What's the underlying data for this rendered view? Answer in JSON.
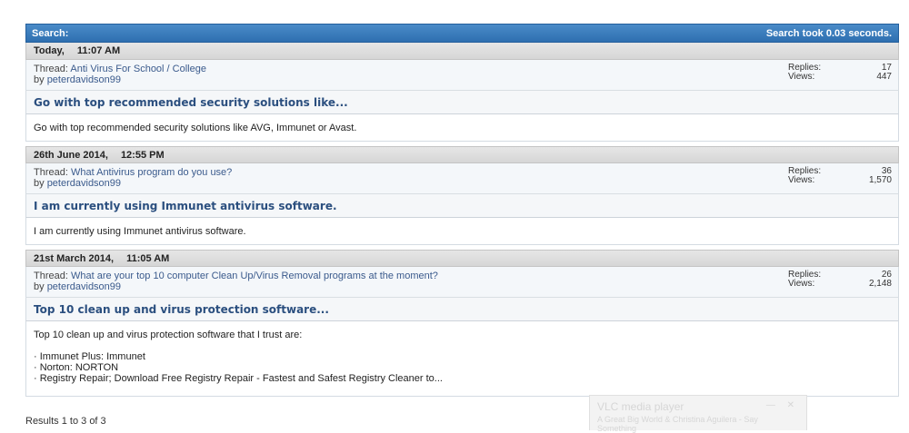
{
  "header": {
    "title": "Search:",
    "time_text": "Search took 0.03 seconds."
  },
  "results": [
    {
      "date": "Today,",
      "time": "11:07 AM",
      "thread_label": "Thread:",
      "thread_title": "Anti Virus For School / College",
      "by_label": "by",
      "author": "peterdavidson99",
      "replies_label": "Replies:",
      "replies": "17",
      "views_label": "Views:",
      "views": "447",
      "post_title": "Go with top recommended security solutions like...",
      "post_lines": [
        "Go with top recommended security solutions like AVG, Immunet or Avast."
      ]
    },
    {
      "date": "26th June 2014,",
      "time": "12:55 PM",
      "thread_label": "Thread:",
      "thread_title": "What Antivirus program do you use?",
      "by_label": "by",
      "author": "peterdavidson99",
      "replies_label": "Replies:",
      "replies": "36",
      "views_label": "Views:",
      "views": "1,570",
      "post_title": "I am currently using Immunet antivirus software.",
      "post_lines": [
        "I am currently using Immunet antivirus software."
      ]
    },
    {
      "date": "21st March 2014,",
      "time": "11:05 AM",
      "thread_label": "Thread:",
      "thread_title": "What are your top 10 computer Clean Up/Virus Removal programs at the moment?",
      "by_label": "by",
      "author": "peterdavidson99",
      "replies_label": "Replies:",
      "replies": "26",
      "views_label": "Views:",
      "views": "2,148",
      "post_title": "Top 10 clean up and virus protection software...",
      "post_lines": [
        "Top 10 clean up and virus protection software that I trust are:",
        "",
        "· Immunet Plus: Immunet",
        "· Norton: NORTON",
        "· Registry Repair; Download Free Registry Repair - Fastest and Safest Registry Cleaner to..."
      ]
    }
  ],
  "footer": {
    "results_text": "Results 1 to 3 of 3"
  },
  "vlc_popup": {
    "title": "VLC media player",
    "subtitle": "A Great Big World & Christina Aguilera - Say Something",
    "controls": "— ✕"
  },
  "colors": {
    "header_bar": "#2e6fb0",
    "link": "#3a5a8c",
    "post_title": "#2b4f7f"
  }
}
